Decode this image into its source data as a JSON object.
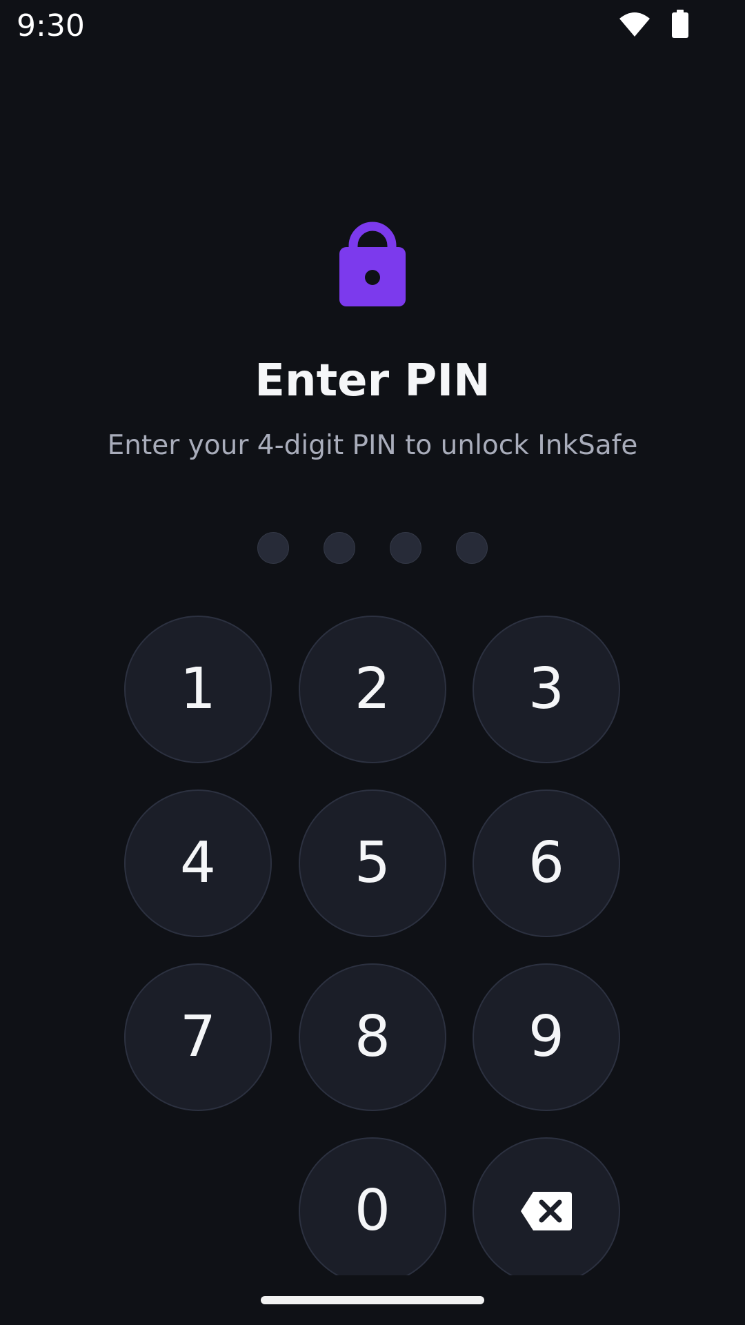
{
  "status_bar": {
    "time": "9:30",
    "wifi_icon": "wifi-icon",
    "battery_icon": "battery-icon"
  },
  "lock": {
    "icon": "lock-icon",
    "color": "#7c3aed"
  },
  "title": "Enter PIN",
  "subtitle": "Enter your 4-digit PIN to unlock InkSafe",
  "pin": {
    "length": 4,
    "entered": 0
  },
  "keypad": {
    "keys": [
      "1",
      "2",
      "3",
      "4",
      "5",
      "6",
      "7",
      "8",
      "9",
      "0"
    ],
    "backspace_icon": "backspace-icon"
  },
  "colors": {
    "background": "#0f1116",
    "key_fill": "#1b1e28",
    "accent": "#7c3aed"
  }
}
